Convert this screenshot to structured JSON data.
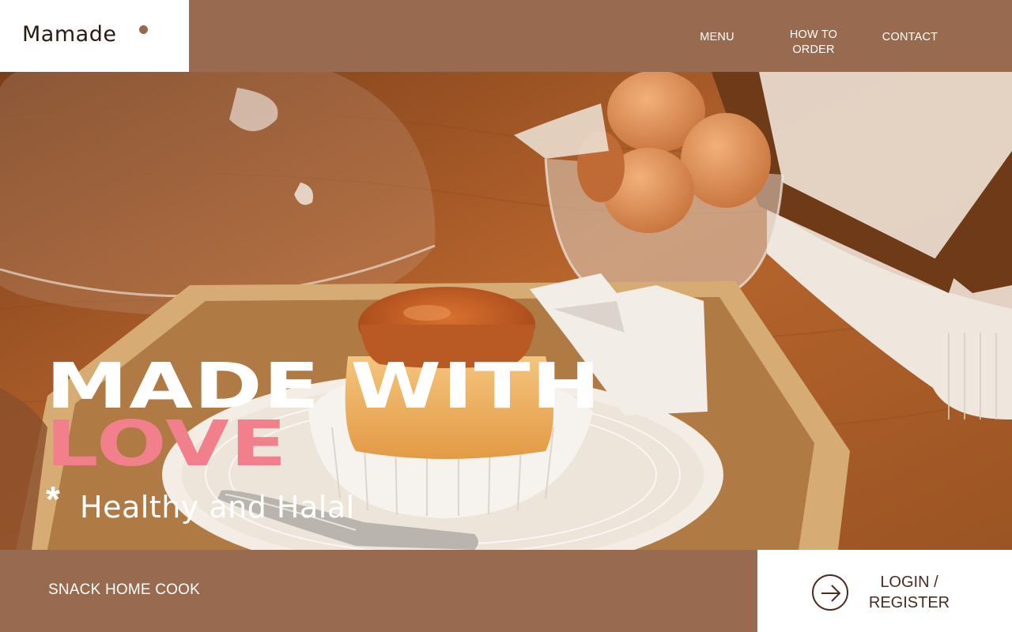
{
  "brand": {
    "logo_text": "Mamade"
  },
  "nav": {
    "items": [
      {
        "label": "MENU"
      },
      {
        "label_line1": "HOW TO",
        "label_line2": "ORDER"
      },
      {
        "label": "CONTACT"
      }
    ]
  },
  "hero": {
    "headline_line1": "MADE WITH",
    "headline_line2": "LOVE",
    "star_glyph": "*",
    "tagline": "Healthy and Halal",
    "image_icon": "flan-dessert-photo"
  },
  "footer": {
    "left_text": "SNACK HOME COOK",
    "login_line1": "LOGIN /",
    "login_line2": "REGISTER",
    "arrow_icon": "arrow-right-circle-icon"
  },
  "colors": {
    "brand_brown": "#986b50",
    "accent_pink": "#f2808c",
    "dark_brown_text": "#4a2c20",
    "white": "#ffffff"
  }
}
